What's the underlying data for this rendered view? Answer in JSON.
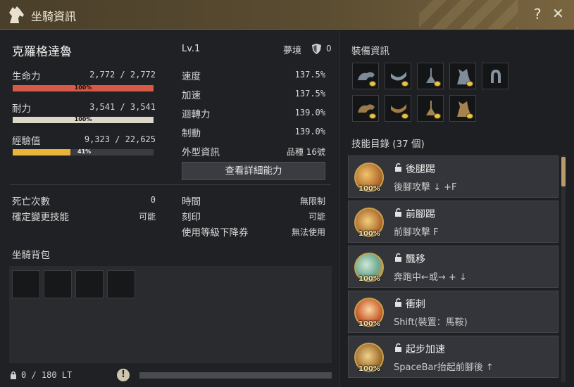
{
  "window": {
    "title": "坐騎資訊",
    "help": "?",
    "close": "✕"
  },
  "mount": {
    "name": "克羅格達魯",
    "level": "Lv.1",
    "dream_label": "夢境",
    "dream_value": "0"
  },
  "vitals": {
    "hp": {
      "label": "生命力",
      "value": "2,772 / 2,772",
      "percent": "100%",
      "fraction": 1.0,
      "color": "#d65a45"
    },
    "stamina": {
      "label": "耐力",
      "value": "3,541 / 3,541",
      "percent": "100%",
      "fraction": 1.0,
      "color": "#dcd7c8"
    },
    "exp": {
      "label": "經驗值",
      "value": "9,323 / 22,625",
      "percent": "41%",
      "fraction": 0.41,
      "color": "#e8b43a"
    }
  },
  "attributes": [
    {
      "label": "速度",
      "value": "137.5%"
    },
    {
      "label": "加速",
      "value": "137.5%"
    },
    {
      "label": "迴轉力",
      "value": "139.0%"
    },
    {
      "label": "制動",
      "value": "139.0%"
    },
    {
      "label": "外型資訊",
      "value": "品種 16號"
    }
  ],
  "detail_button": "查看詳細能力",
  "misc_left": [
    {
      "label": "死亡次數",
      "value": "0"
    },
    {
      "label": "確定變更技能",
      "value": "可能"
    }
  ],
  "misc_right": [
    {
      "label": "時間",
      "value": "無限制"
    },
    {
      "label": "刻印",
      "value": "可能"
    },
    {
      "label": "使用等級下降券",
      "value": "無法使用"
    }
  ],
  "bag": {
    "title": "坐騎背包",
    "weight": "0 / 180 LT",
    "warning_icon": "!"
  },
  "equipment": {
    "title": "裝備資訊",
    "row1": [
      "barding-icon",
      "saddle-icon",
      "stirrups-icon",
      "champron-icon",
      "horseshoe-icon"
    ],
    "row2": [
      "barding-icon",
      "saddle-icon",
      "stirrups-icon",
      "champron-icon"
    ]
  },
  "skills": {
    "title": "技能目錄 (37 個)",
    "items": [
      {
        "name": "後腿踢",
        "key": "後腳攻擊 ↓ +F",
        "mastery": "100%",
        "icon": "kick-icon"
      },
      {
        "name": "前腳踢",
        "key": "前腳攻擊 F",
        "mastery": "100%",
        "icon": "front-kick-icon"
      },
      {
        "name": "飄移",
        "key": "奔跑中←或→ + ↓",
        "mastery": "100%",
        "icon": "drift-icon"
      },
      {
        "name": "衝刺",
        "key": "Shift(裝置：馬鞍)",
        "mastery": "100%",
        "icon": "sprint-icon"
      },
      {
        "name": "起步加速",
        "key": "SpaceBar抬起前腳後 ↑",
        "mastery": "100%",
        "icon": "start-accel-icon"
      }
    ]
  },
  "colors": {
    "accent": "#c9a24a",
    "hp": "#d65a45",
    "exp": "#e8b43a"
  }
}
